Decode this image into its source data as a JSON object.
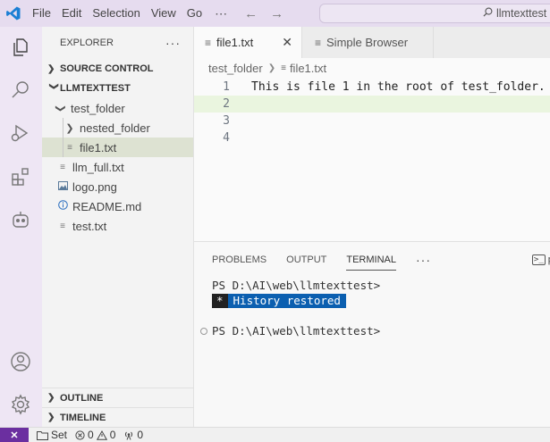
{
  "menu": {
    "items": [
      "File",
      "Edit",
      "Selection",
      "View",
      "Go"
    ],
    "more": "⋯",
    "back_arrow": "←",
    "forward_arrow": "→"
  },
  "command_center": {
    "text": "llmtexttest"
  },
  "explorer": {
    "title": "EXPLORER",
    "more": "···",
    "source_control": "SOURCE CONTROL",
    "workspace": "LLMTEXTTEST",
    "tree": {
      "test_folder": "test_folder",
      "nested_folder": "nested_folder",
      "file1": "file1.txt",
      "llm_full": "llm_full.txt",
      "logo": "logo.png",
      "readme": "README.md",
      "test": "test.txt"
    },
    "outline": "OUTLINE",
    "timeline": "TIMELINE"
  },
  "tabs": [
    {
      "label": "file1.txt"
    },
    {
      "label": "Simple Browser"
    }
  ],
  "breadcrumb": {
    "folder": "test_folder",
    "file": "file1.txt"
  },
  "editor": {
    "lines": [
      {
        "number": "1",
        "text": "This is file 1 in the root of test_folder."
      },
      {
        "number": "2",
        "text": ""
      },
      {
        "number": "3",
        "text": ""
      },
      {
        "number": "4",
        "text": ""
      }
    ]
  },
  "panel": {
    "tabs": [
      "PROBLEMS",
      "OUTPUT",
      "TERMINAL"
    ],
    "active_tab": "TERMINAL",
    "more": "···",
    "shell_label": "po"
  },
  "terminal": {
    "prompt1": "PS D:\\AI\\web\\llmtexttest>",
    "history_star": "*",
    "history_msg": "History restored",
    "prompt2": "PS D:\\AI\\web\\llmtexttest>"
  },
  "status": {
    "remote": "✕",
    "set": "Set",
    "errors": "0",
    "warnings": "0",
    "ports": "0"
  },
  "colors": {
    "titlebar": "#e6dcef",
    "activitybar": "#eee6f4",
    "remote_indicator": "#6b2fa0",
    "history_badge": "#0b5fb0",
    "current_line": "#eaf5df",
    "vscode_blue": "#1a7fd4"
  }
}
